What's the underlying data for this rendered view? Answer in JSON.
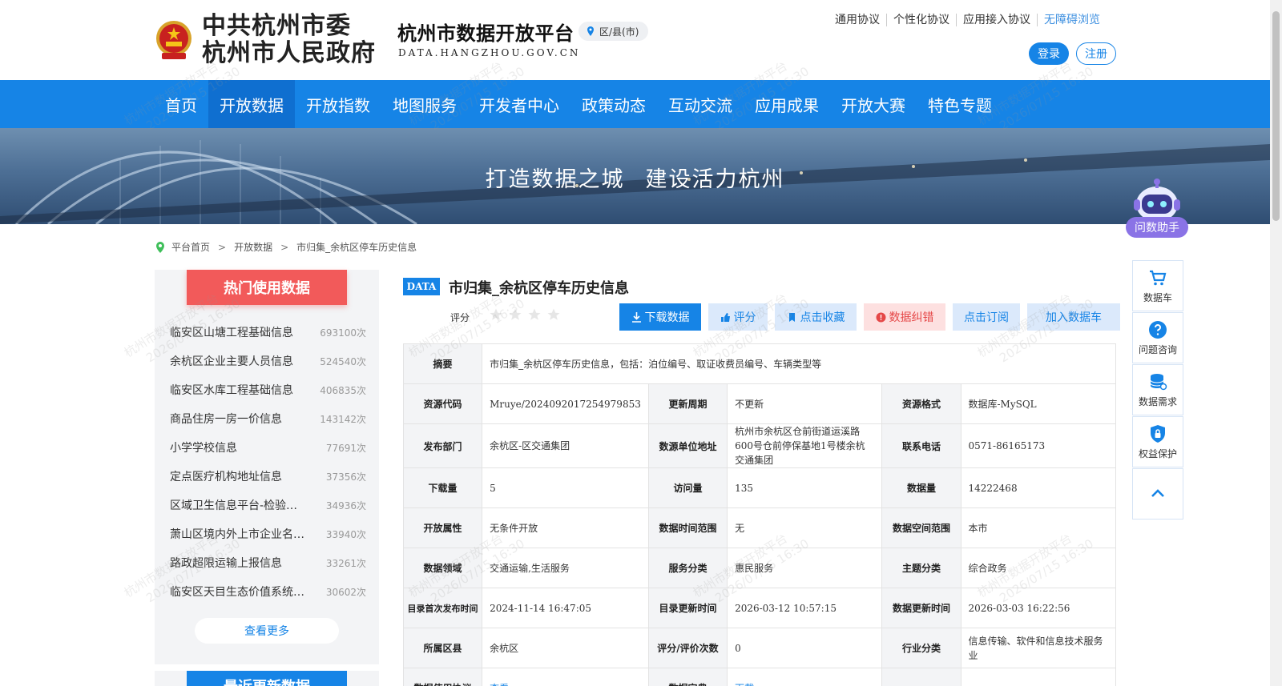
{
  "header": {
    "gov_line1": "中共杭州市委",
    "gov_line2": "杭州市人民政府",
    "platform_title": "杭州市数据开放平台",
    "platform_domain": "DATA.HANGZHOU.GOV.CN",
    "region_label": "区/县(市)",
    "top_links": [
      "通用协议",
      "个性化协议",
      "应用接入协议",
      "无障碍浏览"
    ],
    "login_label": "登录",
    "register_label": "注册"
  },
  "nav": {
    "items": [
      "首页",
      "开放数据",
      "开放指数",
      "地图服务",
      "开发者中心",
      "政策动态",
      "互动交流",
      "应用成果",
      "开放大赛",
      "特色专题"
    ],
    "active": "开放数据"
  },
  "banner": {
    "slogan_left": "打造数据之城",
    "slogan_right": "建设活力杭州"
  },
  "assistant": {
    "label": "问数助手"
  },
  "breadcrumb": {
    "home": "平台首页",
    "section": "开放数据",
    "current": "市归集_余杭区停车历史信息"
  },
  "sidebar": {
    "hot_title": "热门使用数据",
    "hot_items": [
      {
        "name": "临安区山塘工程基础信息",
        "count": "693100次"
      },
      {
        "name": "余杭区企业主要人员信息",
        "count": "524540次"
      },
      {
        "name": "临安区水库工程基础信息",
        "count": "406835次"
      },
      {
        "name": "商品住房一房一价信息",
        "count": "143142次"
      },
      {
        "name": "小学学校信息",
        "count": "77691次"
      },
      {
        "name": "定点医疗机构地址信息",
        "count": "37356次"
      },
      {
        "name": "区域卫生信息平台-检验…",
        "count": "34936次"
      },
      {
        "name": "萧山区境内外上市企业名…",
        "count": "33940次"
      },
      {
        "name": "路政超限运输上报信息",
        "count": "33261次"
      },
      {
        "name": "临安区天目生态价值系统…",
        "count": "30602次"
      }
    ],
    "more_label": "查看更多",
    "recent_title": "最近更新数据"
  },
  "dataset": {
    "badge": "DATA",
    "title": "市归集_余杭区停车历史信息",
    "rating_label": "评分",
    "stars_filled": 0,
    "stars_total": 4,
    "actions": {
      "download": "下载数据",
      "rate": "评分",
      "favorite": "点击收藏",
      "report_error": "数据纠错",
      "subscribe": "点击订阅",
      "add_cart": "加入数据车"
    },
    "summary_key": "摘要",
    "summary_value": "市归集_余杭区停车历史信息，包括：泊位编号、取证收费员编号、车辆类型等",
    "rows": [
      [
        [
          "资源代码",
          "Mruye/2024092017254979853"
        ],
        [
          "更新周期",
          "不更新"
        ],
        [
          "资源格式",
          "数据库-MySQL"
        ]
      ],
      [
        [
          "发布部门",
          "余杭区-区交通集团"
        ],
        [
          "数源单位地址",
          "杭州市余杭区仓前街道运溪路600号仓前停保基地1号楼余杭交通集团"
        ],
        [
          "联系电话",
          "0571-86165173"
        ]
      ],
      [
        [
          "下载量",
          "5"
        ],
        [
          "访问量",
          "135"
        ],
        [
          "数据量",
          "14222468"
        ]
      ],
      [
        [
          "开放属性",
          "无条件开放"
        ],
        [
          "数据时间范围",
          "无"
        ],
        [
          "数据空间范围",
          "本市"
        ]
      ],
      [
        [
          "数据领域",
          "交通运输,生活服务"
        ],
        [
          "服务分类",
          "惠民服务"
        ],
        [
          "主题分类",
          "综合政务"
        ]
      ],
      [
        [
          "目录首次发布时间",
          "2024-11-14 16:47:05"
        ],
        [
          "目录更新时间",
          "2026-03-12 10:57:15"
        ],
        [
          "数据更新时间",
          "2026-03-03 16:22:56"
        ]
      ],
      [
        [
          "所属区县",
          "余杭区"
        ],
        [
          "评分/评价次数",
          "0"
        ],
        [
          "行业分类",
          "信息传输、软件和信息技术服务业"
        ]
      ],
      [
        [
          "数据使用协议",
          "查看"
        ],
        [
          "数据字典",
          "下载"
        ],
        [
          "",
          ""
        ]
      ]
    ]
  },
  "float_panel": {
    "cart": "数据车",
    "consult": "问题咨询",
    "demand": "数据需求",
    "rights": "权益保护"
  },
  "watermark": {
    "line1": "杭州市数据开放平台",
    "line2": "2026/07/15 16:30"
  },
  "colors": {
    "primary": "#1684e6",
    "hot": "#f25a5a",
    "danger_bg": "#fde0e0",
    "light_bg": "#dbe9fb"
  }
}
